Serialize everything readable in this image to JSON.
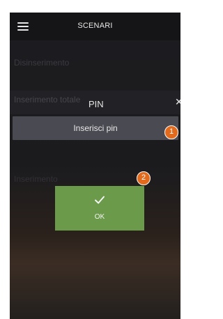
{
  "header": {
    "title": "SCENARI"
  },
  "background_list": {
    "items": [
      "Disinserimento",
      "Inserimento totale",
      "Inserimento"
    ]
  },
  "dialog": {
    "title": "PIN",
    "close_icon": "close-icon",
    "pin_field_placeholder": "Inserisci pin",
    "ok_label": "OK",
    "ok_icon": "checkmark-icon"
  },
  "callouts": {
    "first": "1",
    "second": "2"
  },
  "colors": {
    "ok_button": "#6a9a4a",
    "callout": "#e26a1d",
    "topbar": "#151517",
    "pin_field": "#4a4a52"
  }
}
